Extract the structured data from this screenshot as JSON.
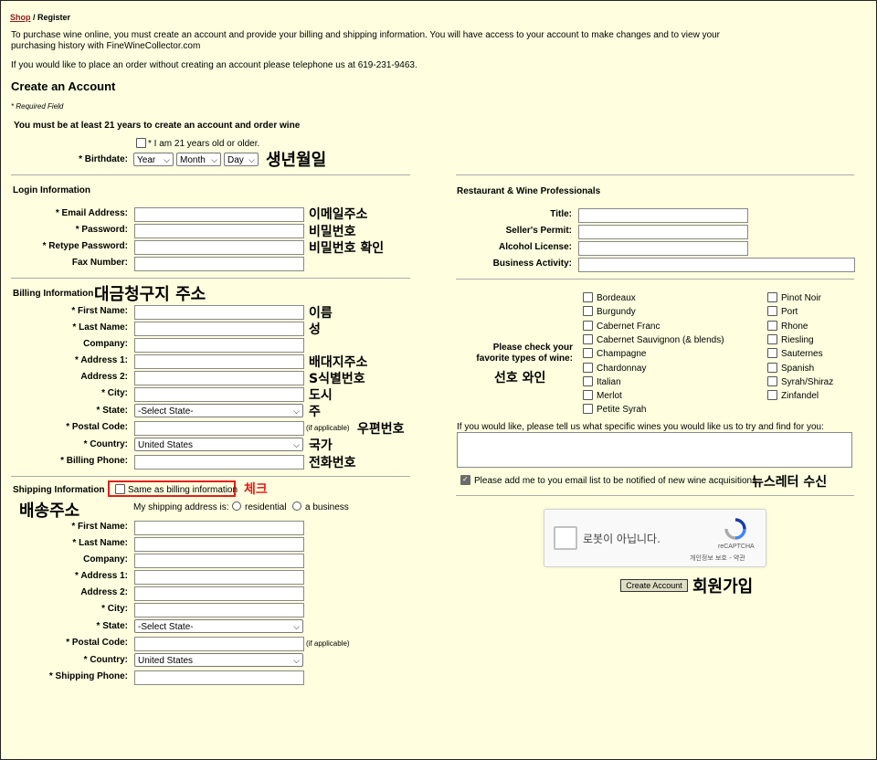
{
  "breadcrumb": {
    "shop": "Shop",
    "sep": " / ",
    "current": "Register"
  },
  "intro": {
    "text1": "To purchase wine online, you must create an account and provide your billing and shipping information. You will have access to your account to make changes and to view your purchasing history with FineWineCollector.com",
    "text2": "If you would like to place an order without creating an account please telephone us at 619-231-9463."
  },
  "page_title": "Create an Account",
  "required_note": "* Required Field",
  "age": {
    "heading": "You must be at least 21 years to create an account and order wine",
    "checkbox_label": "* I am 21 years old or older.",
    "birthdate_label": "* Birthdate:",
    "year": "Year",
    "month": "Month",
    "day": "Day",
    "annotation": "생년월일"
  },
  "login": {
    "title": "Login Information",
    "email": "* Email Address:",
    "password": "* Password:",
    "retype": "* Retype Password:",
    "fax": "Fax Number:",
    "ann_email": "이메일주소",
    "ann_password": "비밀번호",
    "ann_retype": "비밀번호 확인"
  },
  "billing": {
    "title": "Billing Information",
    "annotation": "대금청구지 주소",
    "first": "* First Name:",
    "last": "* Last Name:",
    "company": "Company:",
    "addr1": "* Address 1:",
    "addr2": "Address 2:",
    "city": "* City:",
    "state": "* State:",
    "state_value": "-Select State-",
    "postal": "* Postal Code:",
    "postal_note": "(if applicable)",
    "country": "* Country:",
    "country_value": "United States",
    "phone": "* Billing Phone:",
    "ann_first": "이름",
    "ann_last": "성",
    "ann_addr1": "배대지주소",
    "ann_addr2": "S식별번호",
    "ann_city": "도시",
    "ann_state": "주",
    "ann_postal": "우편번호",
    "ann_country": "국가",
    "ann_phone": "전화번호"
  },
  "shipping": {
    "title": "Shipping Information",
    "annotation": "배송주소",
    "same_label": "Same as billing information",
    "same_annotation": "체크",
    "my_address": "My shipping address is:",
    "residential": "residential",
    "business": "a business",
    "first": "* First Name:",
    "last": "* Last Name:",
    "company": "Company:",
    "addr1": "* Address 1:",
    "addr2": "Address 2:",
    "city": "* City:",
    "state": "* State:",
    "state_value": "-Select State-",
    "postal": "* Postal Code:",
    "postal_note": "(if applicable)",
    "country": "* Country:",
    "country_value": "United States",
    "phone": "* Shipping Phone:"
  },
  "pro": {
    "title": "Restaurant & Wine Professionals",
    "job": "Title:",
    "permit": "Seller's Permit:",
    "license": "Alcohol License:",
    "activity": "Business Activity:"
  },
  "wines": {
    "prompt": "Please check your favorite types of wine:",
    "annotation": "선호 와인",
    "col1": [
      "Bordeaux",
      "Burgundy",
      "Cabernet Franc",
      "Cabernet Sauvignon (& blends)",
      "Champagne",
      "Chardonnay",
      "Italian",
      "Merlot",
      "Petite Syrah"
    ],
    "col2": [
      "Pinot Noir",
      "Port",
      "Rhone",
      "Riesling",
      "Sauternes",
      "Spanish",
      "Syrah/Shiraz",
      "Zinfandel"
    ],
    "specific": "If you would like, please tell us what specific wines you would like us to try and find for you:"
  },
  "newsletter": {
    "label": "Please add me to you email list to be notified of new wine acquisitions",
    "annotation": "뉴스레터 수신"
  },
  "captcha": {
    "label": "로봇이 아닙니다.",
    "brand": "reCAPTCHA",
    "links": "개인정보 보호 - 약관"
  },
  "submit": {
    "label": "Create Account",
    "annotation": "회원가입"
  },
  "colors": {
    "background": "#ffffe0",
    "link": "#8b1a1a",
    "annotation_red": "#e0201b",
    "button": "#dedec4"
  }
}
